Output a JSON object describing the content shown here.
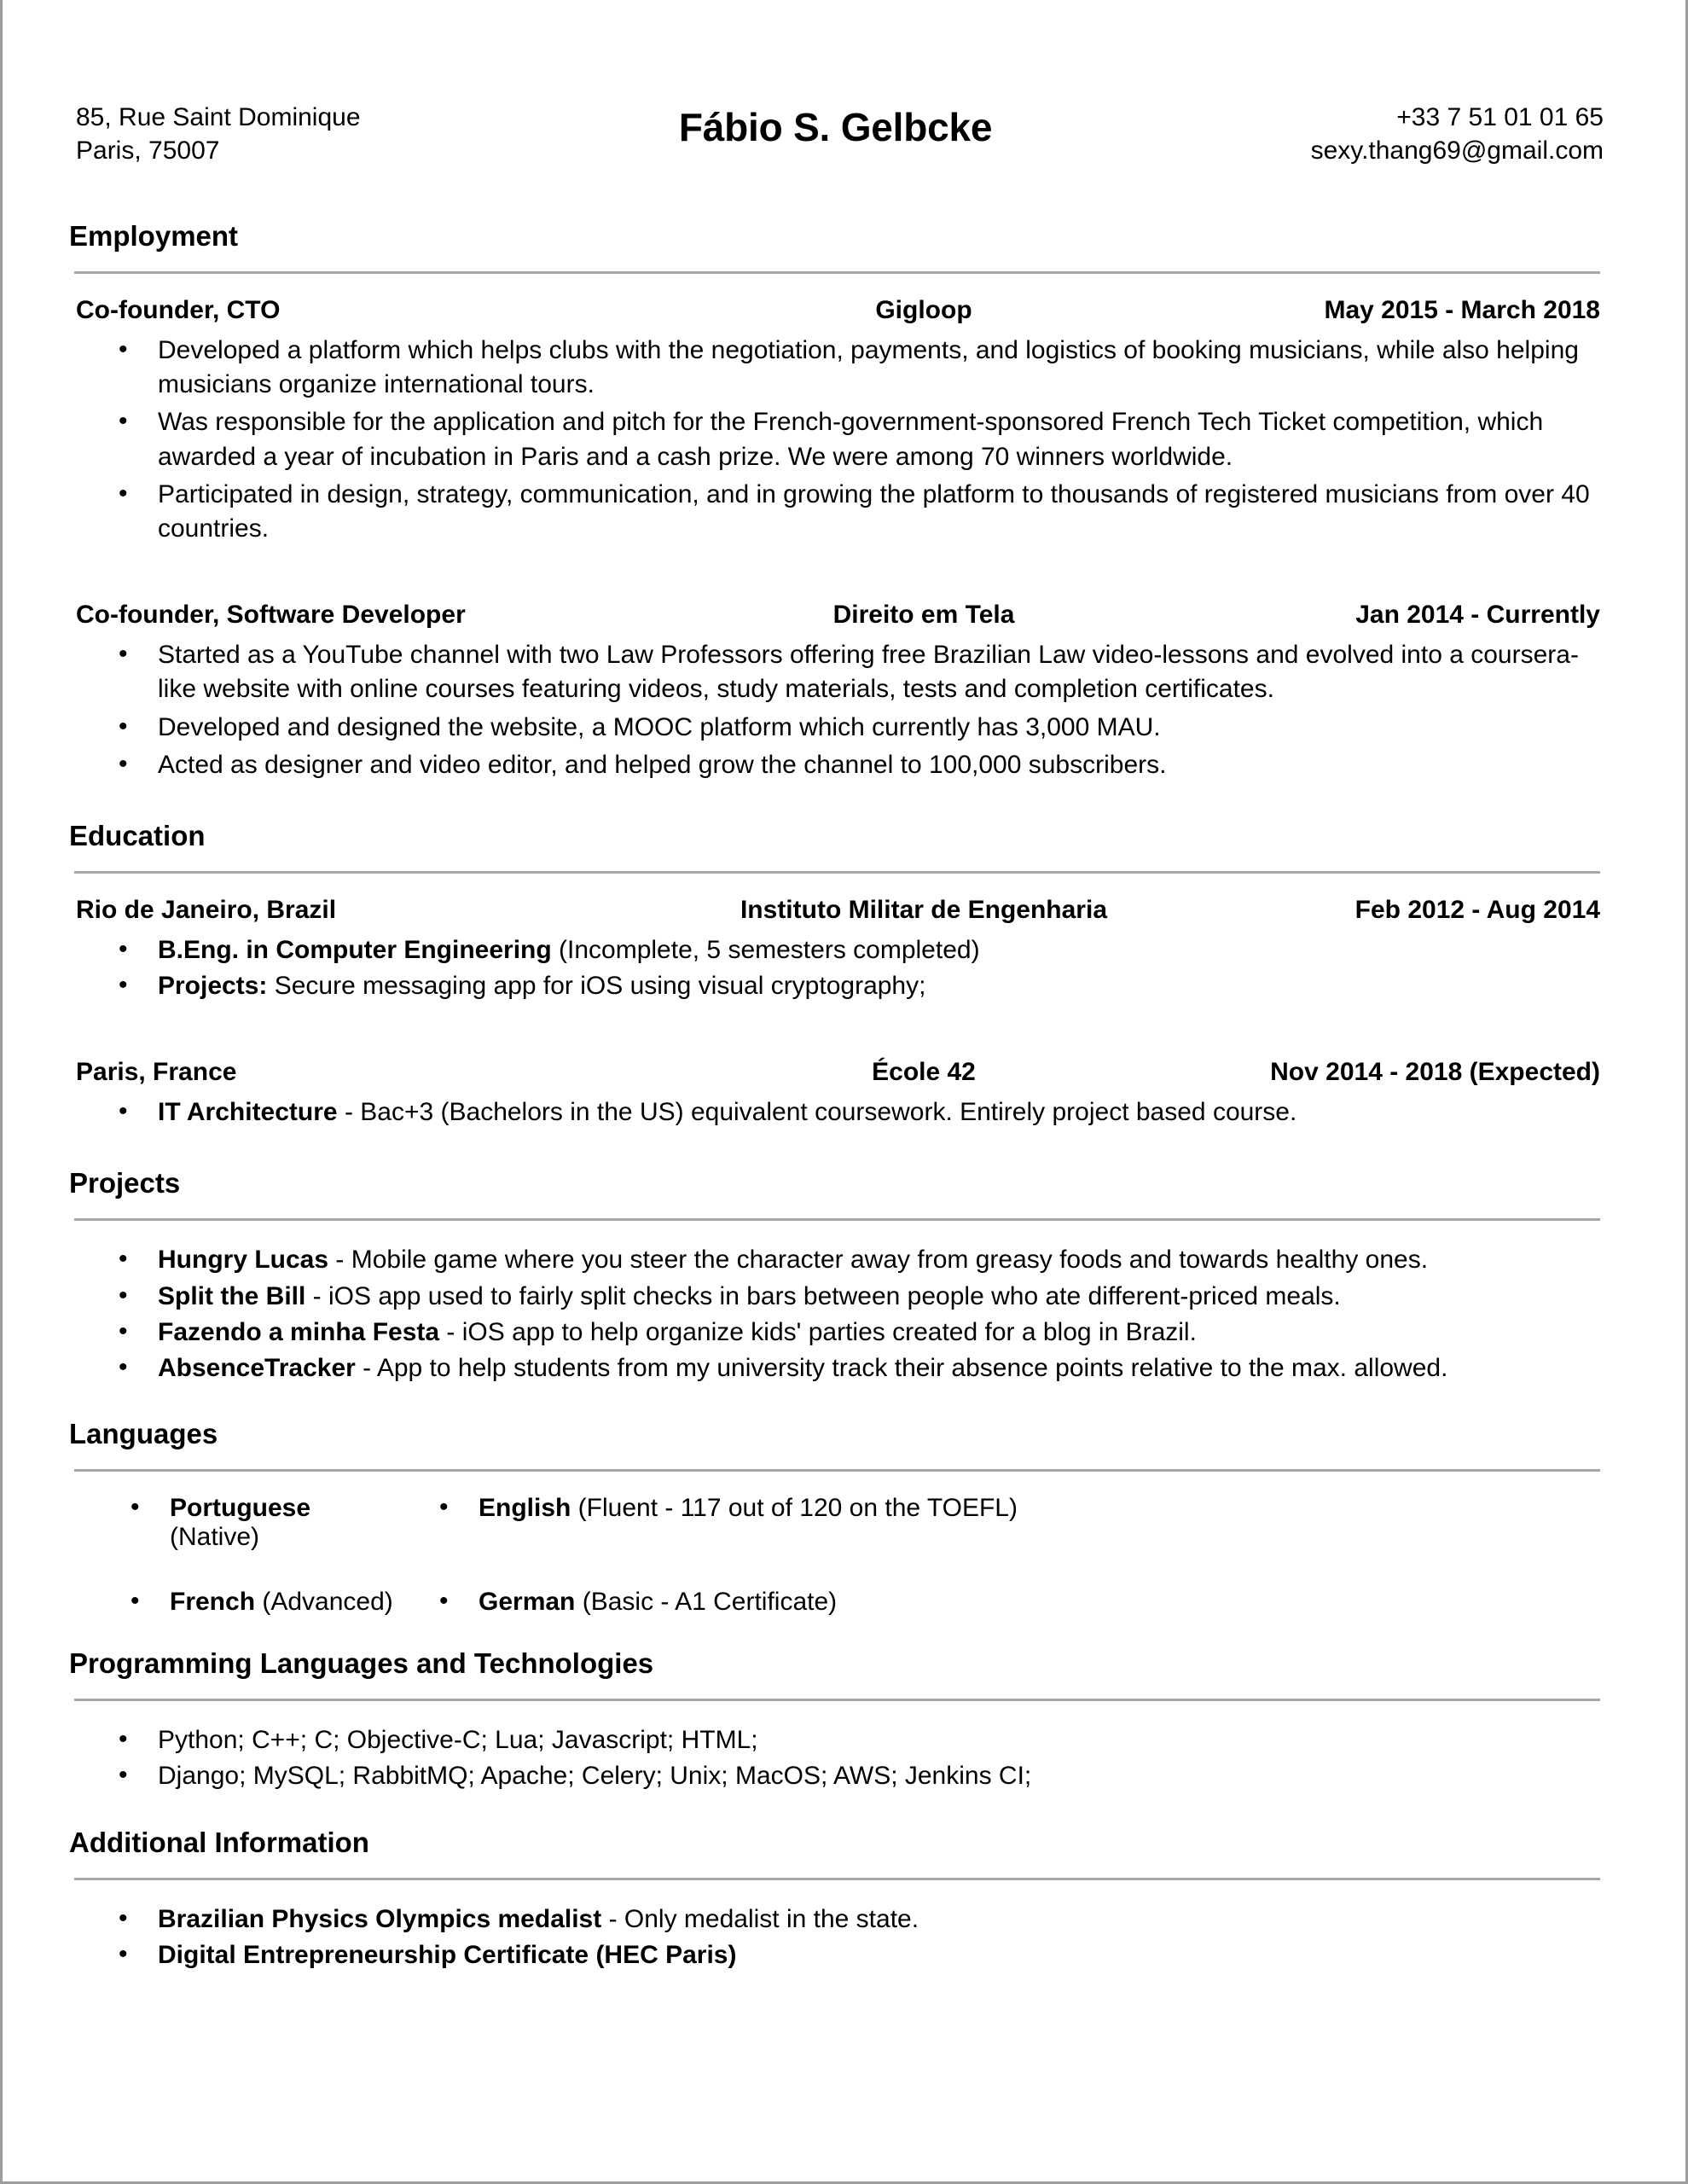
{
  "header": {
    "address_line1": "85, Rue Saint Dominique",
    "address_line2": "Paris, 75007",
    "name": "Fábio S. Gelbcke",
    "phone": "+33 7 51 01 01 65",
    "email": "sexy.thang69@gmail.com"
  },
  "sections": {
    "employment": {
      "title": "Employment"
    },
    "education": {
      "title": "Education"
    },
    "projects": {
      "title": "Projects"
    },
    "languages": {
      "title": "Languages"
    },
    "programming": {
      "title": "Programming Languages and Technologies"
    },
    "additional": {
      "title": "Additional Information"
    }
  },
  "employment": [
    {
      "role": "Co-founder, CTO",
      "org": "Gigloop",
      "dates": "May 2015 - March 2018",
      "bullets": [
        "Developed a platform which helps clubs with the negotiation, payments, and logistics of booking musicians, while also helping musicians organize international tours.",
        "Was responsible for the application and pitch for the French-government-sponsored French Tech Ticket competition, which awarded a year of incubation in Paris and a cash prize. We were among 70 winners worldwide.",
        "Participated in design, strategy, communication, and in growing the platform to thousands of registered musicians from over 40 countries."
      ]
    },
    {
      "role": "Co-founder, Software Developer",
      "org": "Direito em Tela",
      "dates": "Jan 2014 - Currently",
      "bullets": [
        "Started as a YouTube channel with two Law Professors offering free Brazilian Law video-lessons and evolved into a coursera-like website with online courses featuring videos, study materials, tests and completion certificates.",
        "Developed and designed the website, a MOOC platform which currently has 3,000 MAU.",
        "Acted as designer and video editor, and helped grow the channel to 100,000 subscribers."
      ]
    }
  ],
  "education": [
    {
      "role": "Rio de Janeiro, Brazil",
      "org": "Instituto Militar de Engenharia",
      "dates": "Feb 2012 - Aug 2014",
      "bullets": [
        {
          "bold": "B.Eng. in Computer Engineering",
          "rest": " (Incomplete, 5 semesters completed)"
        },
        {
          "bold": "Projects:",
          "rest": " Secure messaging app for iOS using visual cryptography;"
        }
      ]
    },
    {
      "role": "Paris, France",
      "org": "École 42",
      "dates": "Nov 2014 - 2018 (Expected)",
      "bullets": [
        {
          "bold": "IT Architecture",
          "rest": " - Bac+3 (Bachelors in the US) equivalent coursework. Entirely project based course."
        }
      ]
    }
  ],
  "projects": [
    {
      "bold": "Hungry Lucas",
      "rest": " - Mobile game where you steer the character away from greasy foods and towards healthy ones."
    },
    {
      "bold": "Split the Bill",
      "rest": " - iOS app used to fairly split checks in bars between people who ate different-priced meals."
    },
    {
      "bold": "Fazendo a minha Festa",
      "rest": " - iOS app to help organize kids' parties created for a blog in Brazil."
    },
    {
      "bold": "AbsenceTracker",
      "rest": " - App to help students from my university track their absence points relative to the max. allowed."
    }
  ],
  "languages": [
    {
      "name": "Portuguese",
      "level": " (Native)"
    },
    {
      "name": "English",
      "level": " (Fluent - 117 out of 120 on the TOEFL)"
    },
    {
      "name": "French",
      "level": " (Advanced)"
    },
    {
      "name": "German",
      "level": " (Basic - A1 Certificate)"
    }
  ],
  "programming": [
    "Python; C++; C; Objective-C; Lua; Javascript; HTML;",
    "Django; MySQL; RabbitMQ; Apache; Celery; Unix; MacOS; AWS; Jenkins CI;"
  ],
  "additional": [
    {
      "bold": "Brazilian Physics Olympics medalist",
      "rest": " - Only medalist in the state."
    },
    {
      "bold": "Digital Entrepreneurship Certificate (HEC Paris)",
      "rest": ""
    }
  ],
  "colors": {
    "text": "#000000",
    "rule": "#a6a6a6",
    "page_border": "#9d9d9d"
  }
}
